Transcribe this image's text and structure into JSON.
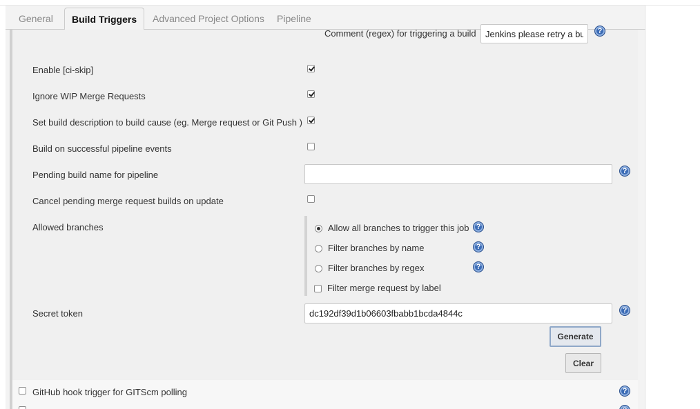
{
  "tabs": [
    {
      "label": "General",
      "active": false
    },
    {
      "label": "Build Triggers",
      "active": true
    },
    {
      "label": "Advanced Project Options",
      "active": false
    },
    {
      "label": "Pipeline",
      "active": false
    }
  ],
  "comment_regex": {
    "label": "Comment (regex) for triggering a build",
    "value": "Jenkins please retry a bui"
  },
  "options": {
    "ci_skip": {
      "label": "Enable [ci-skip]",
      "checked": true
    },
    "ignore_wip": {
      "label": "Ignore WIP Merge Requests",
      "checked": true
    },
    "set_description": {
      "label": "Set build description to build cause (eg. Merge request or Git Push )",
      "checked": true
    },
    "pipeline_events": {
      "label": "Build on successful pipeline events",
      "checked": false
    },
    "pending_build_name": {
      "label": "Pending build name for pipeline",
      "value": ""
    },
    "cancel_pending": {
      "label": "Cancel pending merge request builds on update",
      "checked": false
    }
  },
  "allowed_branches": {
    "label": "Allowed branches",
    "choices": [
      {
        "label": "Allow all branches to trigger this job",
        "selected": true
      },
      {
        "label": "Filter branches by name",
        "selected": false
      },
      {
        "label": "Filter branches by regex",
        "selected": false
      }
    ],
    "filter_label": {
      "label": "Filter merge request by label",
      "checked": false
    }
  },
  "secret_token": {
    "label": "Secret token",
    "value": "dc192df39d1b06603fbabb1bcda4844c",
    "generate_label": "Generate",
    "clear_label": "Clear"
  },
  "github_hook": {
    "label": "GitHub hook trigger for GITScm polling",
    "checked": false
  },
  "help_glyph": "?",
  "colors": {
    "help_icon": "#3b6bb5",
    "panel_bg": "#f0f0f0",
    "tab_border": "#cccccc"
  }
}
